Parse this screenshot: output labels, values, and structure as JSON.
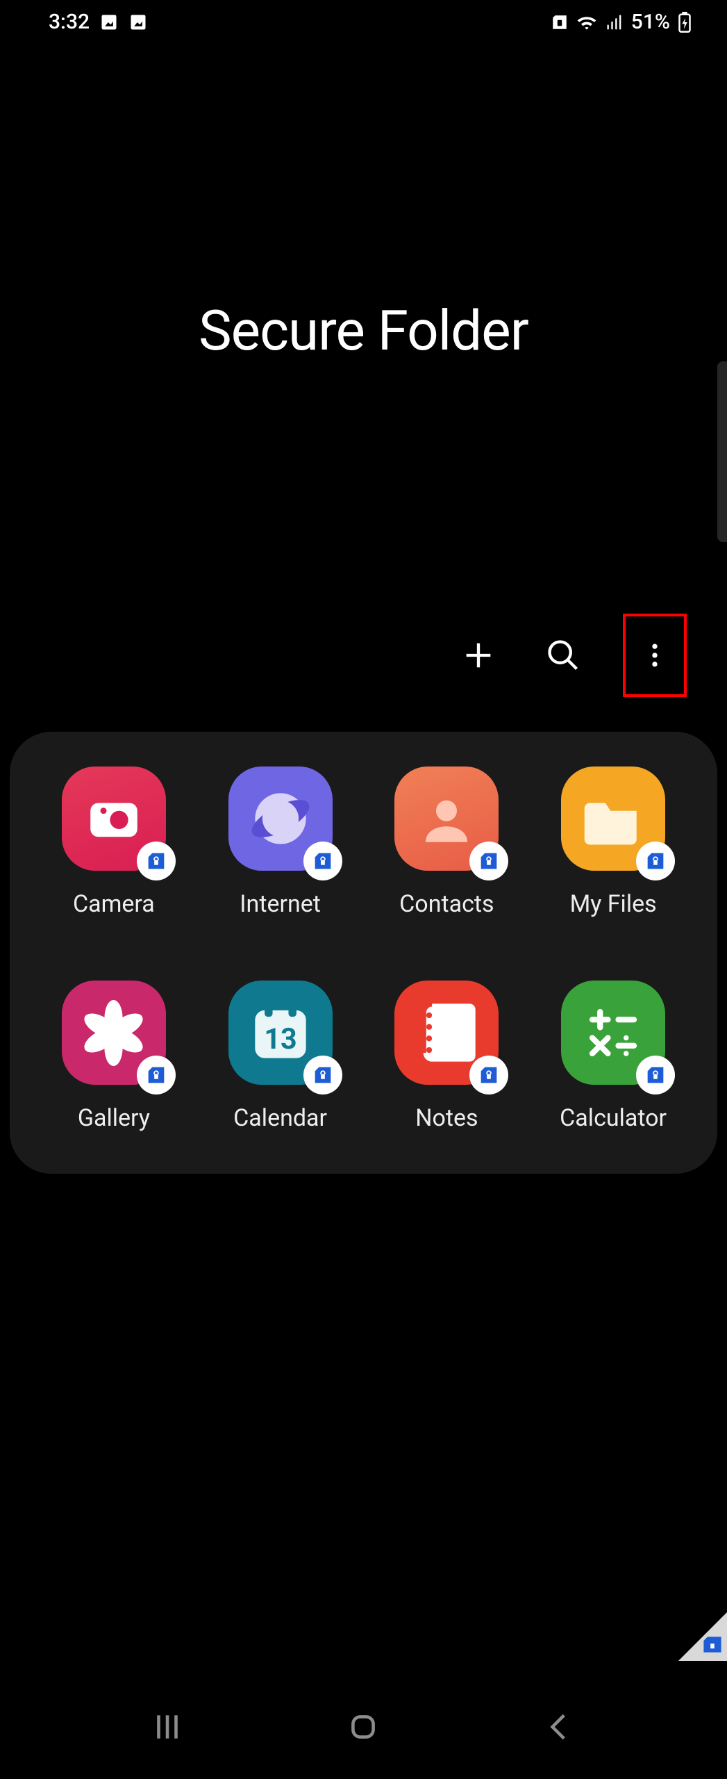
{
  "status": {
    "time": "3:32",
    "battery_text": "51%"
  },
  "title": "Secure Folder",
  "apps": [
    {
      "id": "camera",
      "label": "Camera"
    },
    {
      "id": "internet",
      "label": "Internet"
    },
    {
      "id": "contacts",
      "label": "Contacts"
    },
    {
      "id": "files",
      "label": "My Files"
    },
    {
      "id": "gallery",
      "label": "Gallery"
    },
    {
      "id": "calendar",
      "label": "Calendar"
    },
    {
      "id": "notes",
      "label": "Notes"
    },
    {
      "id": "calc",
      "label": "Calculator"
    }
  ],
  "calendar_day": "13"
}
